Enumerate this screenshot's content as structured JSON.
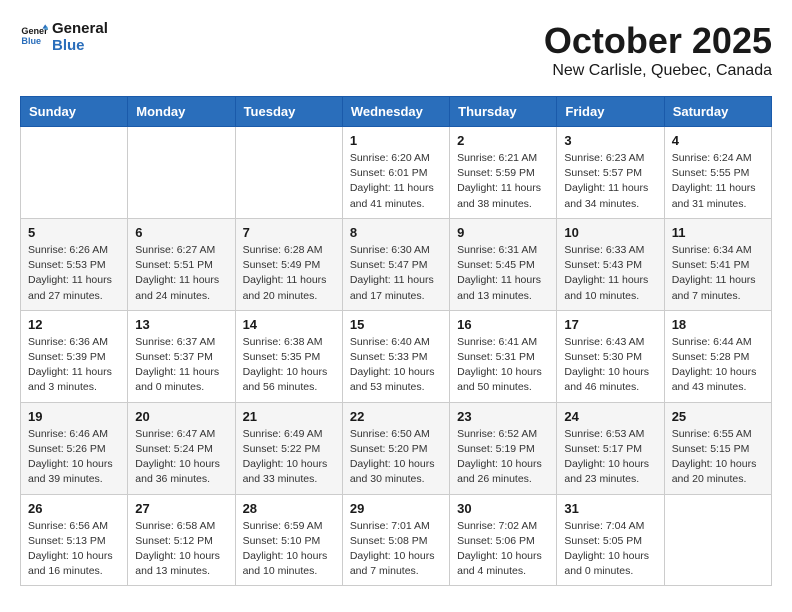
{
  "logo": {
    "line1": "General",
    "line2": "Blue"
  },
  "title": "October 2025",
  "location": "New Carlisle, Quebec, Canada",
  "headers": [
    "Sunday",
    "Monday",
    "Tuesday",
    "Wednesday",
    "Thursday",
    "Friday",
    "Saturday"
  ],
  "weeks": [
    [
      {
        "day": "",
        "info": ""
      },
      {
        "day": "",
        "info": ""
      },
      {
        "day": "",
        "info": ""
      },
      {
        "day": "1",
        "info": "Sunrise: 6:20 AM\nSunset: 6:01 PM\nDaylight: 11 hours\nand 41 minutes."
      },
      {
        "day": "2",
        "info": "Sunrise: 6:21 AM\nSunset: 5:59 PM\nDaylight: 11 hours\nand 38 minutes."
      },
      {
        "day": "3",
        "info": "Sunrise: 6:23 AM\nSunset: 5:57 PM\nDaylight: 11 hours\nand 34 minutes."
      },
      {
        "day": "4",
        "info": "Sunrise: 6:24 AM\nSunset: 5:55 PM\nDaylight: 11 hours\nand 31 minutes."
      }
    ],
    [
      {
        "day": "5",
        "info": "Sunrise: 6:26 AM\nSunset: 5:53 PM\nDaylight: 11 hours\nand 27 minutes."
      },
      {
        "day": "6",
        "info": "Sunrise: 6:27 AM\nSunset: 5:51 PM\nDaylight: 11 hours\nand 24 minutes."
      },
      {
        "day": "7",
        "info": "Sunrise: 6:28 AM\nSunset: 5:49 PM\nDaylight: 11 hours\nand 20 minutes."
      },
      {
        "day": "8",
        "info": "Sunrise: 6:30 AM\nSunset: 5:47 PM\nDaylight: 11 hours\nand 17 minutes."
      },
      {
        "day": "9",
        "info": "Sunrise: 6:31 AM\nSunset: 5:45 PM\nDaylight: 11 hours\nand 13 minutes."
      },
      {
        "day": "10",
        "info": "Sunrise: 6:33 AM\nSunset: 5:43 PM\nDaylight: 11 hours\nand 10 minutes."
      },
      {
        "day": "11",
        "info": "Sunrise: 6:34 AM\nSunset: 5:41 PM\nDaylight: 11 hours\nand 7 minutes."
      }
    ],
    [
      {
        "day": "12",
        "info": "Sunrise: 6:36 AM\nSunset: 5:39 PM\nDaylight: 11 hours\nand 3 minutes."
      },
      {
        "day": "13",
        "info": "Sunrise: 6:37 AM\nSunset: 5:37 PM\nDaylight: 11 hours\nand 0 minutes."
      },
      {
        "day": "14",
        "info": "Sunrise: 6:38 AM\nSunset: 5:35 PM\nDaylight: 10 hours\nand 56 minutes."
      },
      {
        "day": "15",
        "info": "Sunrise: 6:40 AM\nSunset: 5:33 PM\nDaylight: 10 hours\nand 53 minutes."
      },
      {
        "day": "16",
        "info": "Sunrise: 6:41 AM\nSunset: 5:31 PM\nDaylight: 10 hours\nand 50 minutes."
      },
      {
        "day": "17",
        "info": "Sunrise: 6:43 AM\nSunset: 5:30 PM\nDaylight: 10 hours\nand 46 minutes."
      },
      {
        "day": "18",
        "info": "Sunrise: 6:44 AM\nSunset: 5:28 PM\nDaylight: 10 hours\nand 43 minutes."
      }
    ],
    [
      {
        "day": "19",
        "info": "Sunrise: 6:46 AM\nSunset: 5:26 PM\nDaylight: 10 hours\nand 39 minutes."
      },
      {
        "day": "20",
        "info": "Sunrise: 6:47 AM\nSunset: 5:24 PM\nDaylight: 10 hours\nand 36 minutes."
      },
      {
        "day": "21",
        "info": "Sunrise: 6:49 AM\nSunset: 5:22 PM\nDaylight: 10 hours\nand 33 minutes."
      },
      {
        "day": "22",
        "info": "Sunrise: 6:50 AM\nSunset: 5:20 PM\nDaylight: 10 hours\nand 30 minutes."
      },
      {
        "day": "23",
        "info": "Sunrise: 6:52 AM\nSunset: 5:19 PM\nDaylight: 10 hours\nand 26 minutes."
      },
      {
        "day": "24",
        "info": "Sunrise: 6:53 AM\nSunset: 5:17 PM\nDaylight: 10 hours\nand 23 minutes."
      },
      {
        "day": "25",
        "info": "Sunrise: 6:55 AM\nSunset: 5:15 PM\nDaylight: 10 hours\nand 20 minutes."
      }
    ],
    [
      {
        "day": "26",
        "info": "Sunrise: 6:56 AM\nSunset: 5:13 PM\nDaylight: 10 hours\nand 16 minutes."
      },
      {
        "day": "27",
        "info": "Sunrise: 6:58 AM\nSunset: 5:12 PM\nDaylight: 10 hours\nand 13 minutes."
      },
      {
        "day": "28",
        "info": "Sunrise: 6:59 AM\nSunset: 5:10 PM\nDaylight: 10 hours\nand 10 minutes."
      },
      {
        "day": "29",
        "info": "Sunrise: 7:01 AM\nSunset: 5:08 PM\nDaylight: 10 hours\nand 7 minutes."
      },
      {
        "day": "30",
        "info": "Sunrise: 7:02 AM\nSunset: 5:06 PM\nDaylight: 10 hours\nand 4 minutes."
      },
      {
        "day": "31",
        "info": "Sunrise: 7:04 AM\nSunset: 5:05 PM\nDaylight: 10 hours\nand 0 minutes."
      },
      {
        "day": "",
        "info": ""
      }
    ]
  ]
}
